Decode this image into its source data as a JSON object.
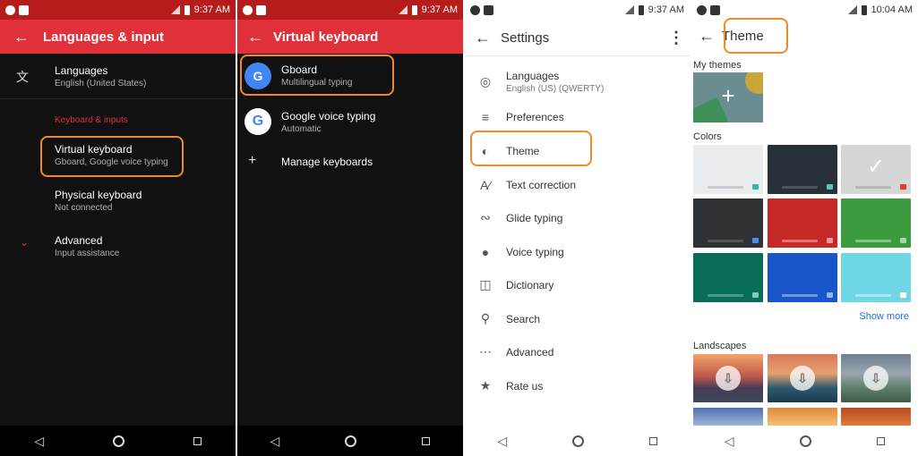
{
  "status": {
    "time_a": "9:37 AM",
    "time_b": "9:37 AM",
    "time_c": "9:37 AM",
    "time_d": "10:04 AM"
  },
  "panel1": {
    "title": "Languages & input",
    "languages_title": "Languages",
    "languages_sub": "English (United States)",
    "section": "Keyboard & inputs",
    "virtual_title": "Virtual keyboard",
    "virtual_sub": "Gboard, Google voice typing",
    "physical_title": "Physical keyboard",
    "physical_sub": "Not connected",
    "advanced_title": "Advanced",
    "advanced_sub": "Input assistance"
  },
  "panel2": {
    "title": "Virtual keyboard",
    "gboard_title": "Gboard",
    "gboard_sub": "Multilingual typing",
    "voice_title": "Google voice typing",
    "voice_sub": "Automatic",
    "manage": "Manage keyboards"
  },
  "panel3": {
    "title": "Settings",
    "languages_title": "Languages",
    "languages_sub": "English (US) (QWERTY)",
    "items": [
      "Preferences",
      "Theme",
      "Text correction",
      "Glide typing",
      "Voice typing",
      "Dictionary",
      "Search",
      "Advanced",
      "Rate us"
    ]
  },
  "panel4": {
    "title": "Theme",
    "my_themes": "My themes",
    "colors": "Colors",
    "show_more": "Show more",
    "landscapes": "Landscapes"
  },
  "colors": {
    "accent_red": "#e0303a",
    "highlight": "#f08a24",
    "link_blue": "#1a73e8"
  }
}
